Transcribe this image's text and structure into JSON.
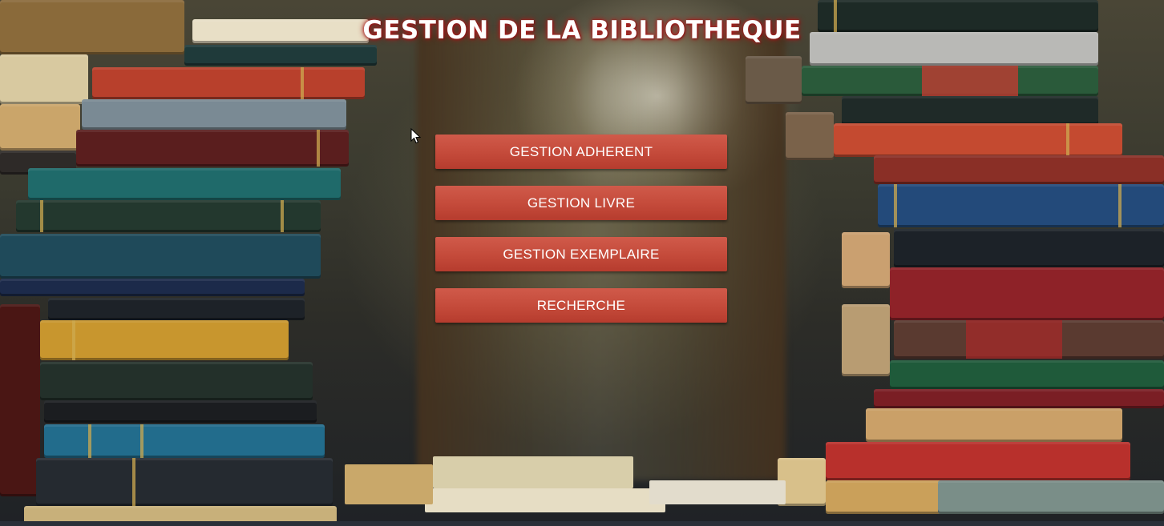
{
  "app": {
    "title": "GESTION DE LA BIBLIOTHEQUE"
  },
  "menu": {
    "items": [
      {
        "label": "GESTION ADHERENT"
      },
      {
        "label": "GESTION LIVRE"
      },
      {
        "label": "GESTION EXEMPLAIRE"
      },
      {
        "label": "RECHERCHE"
      }
    ]
  },
  "colors": {
    "button": "#c44a3a",
    "title_glow": "#b22222"
  }
}
